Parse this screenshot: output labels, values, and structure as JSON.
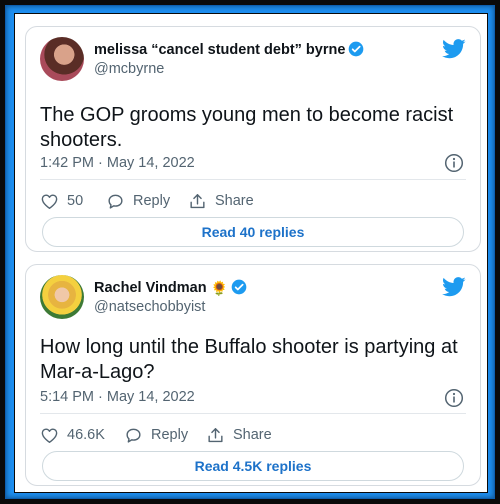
{
  "tweets": [
    {
      "author_name": "melissa “cancel student debt” byrne",
      "handle": "@mcbyrne",
      "emoji": "",
      "text": "The GOP grooms young men to become racist shooters.",
      "timestamp": "1:42 PM · May 14, 2022",
      "likes": "50",
      "reply_label": "Reply",
      "share_label": "Share",
      "replies_button": "Read 40 replies",
      "avatar_icon": "profile-photo-icon"
    },
    {
      "author_name": "Rachel Vindman",
      "handle": "@natsechobbyist",
      "emoji": "🌻",
      "text": "How long until the Buffalo shooter is partying at Mar-a-Lago?",
      "timestamp": "5:14 PM · May 14, 2022",
      "likes": "46.6K",
      "reply_label": "Reply",
      "share_label": "Share",
      "replies_button": "Read 4.5K replies",
      "avatar_icon": "profile-photo-icon"
    }
  ],
  "colors": {
    "frame_blue": "#1d8ef0",
    "twitter_blue": "#1d9bf0",
    "link_blue": "#1d72c9",
    "muted_text": "#536471"
  }
}
